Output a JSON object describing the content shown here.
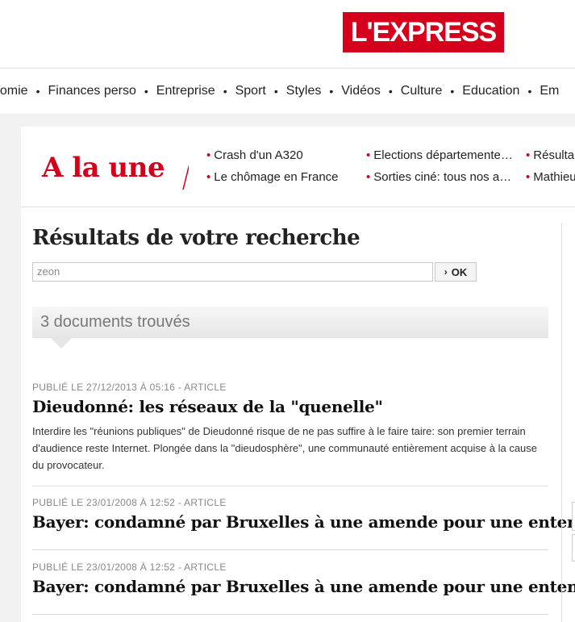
{
  "logo": {
    "text": "L'EXPRESS"
  },
  "nav": {
    "items": [
      "nomie",
      "Finances perso",
      "Entreprise",
      "Sport",
      "Styles",
      "Vidéos",
      "Culture",
      "Education",
      "Em"
    ],
    "separator": "•"
  },
  "alaune": {
    "title": "A la une",
    "links": [
      "Crash d'un A320",
      "Le chômage en France",
      "Elections départemente…",
      "Sorties ciné: tous nos a…",
      "Résulta",
      "Mathieu"
    ]
  },
  "search": {
    "heading": "Résultats de votre recherche",
    "query": "zeon",
    "ok_label": "OK",
    "count_text": "3 documents trouvés"
  },
  "results": [
    {
      "meta": "PUBLIÉ LE 27/12/2013 À 05:16 - ARTICLE",
      "title": "Dieudonné: les réseaux de la \"quenelle\"",
      "desc": "Interdire les \"réunions publiques\" de Dieudonné risque de ne pas suffire à le faire taire: son premier terrain d'audience reste Internet. Plongée dans la \"dieudosphère\", une communauté entièrement acquise à la cause du provocateur."
    },
    {
      "meta": "PUBLIÉ LE 23/01/2008 À 12:52 - ARTICLE",
      "title": "Bayer: condamné par Bruxelles à une amende pour une entente.",
      "desc": ""
    },
    {
      "meta": "PUBLIÉ LE 23/01/2008 À 12:52 - ARTICLE",
      "title": "Bayer: condamné par Bruxelles à une amende pour une entente.",
      "desc": ""
    }
  ],
  "colors": {
    "brand": "#d5001c",
    "link_dot": "#d5001c"
  }
}
